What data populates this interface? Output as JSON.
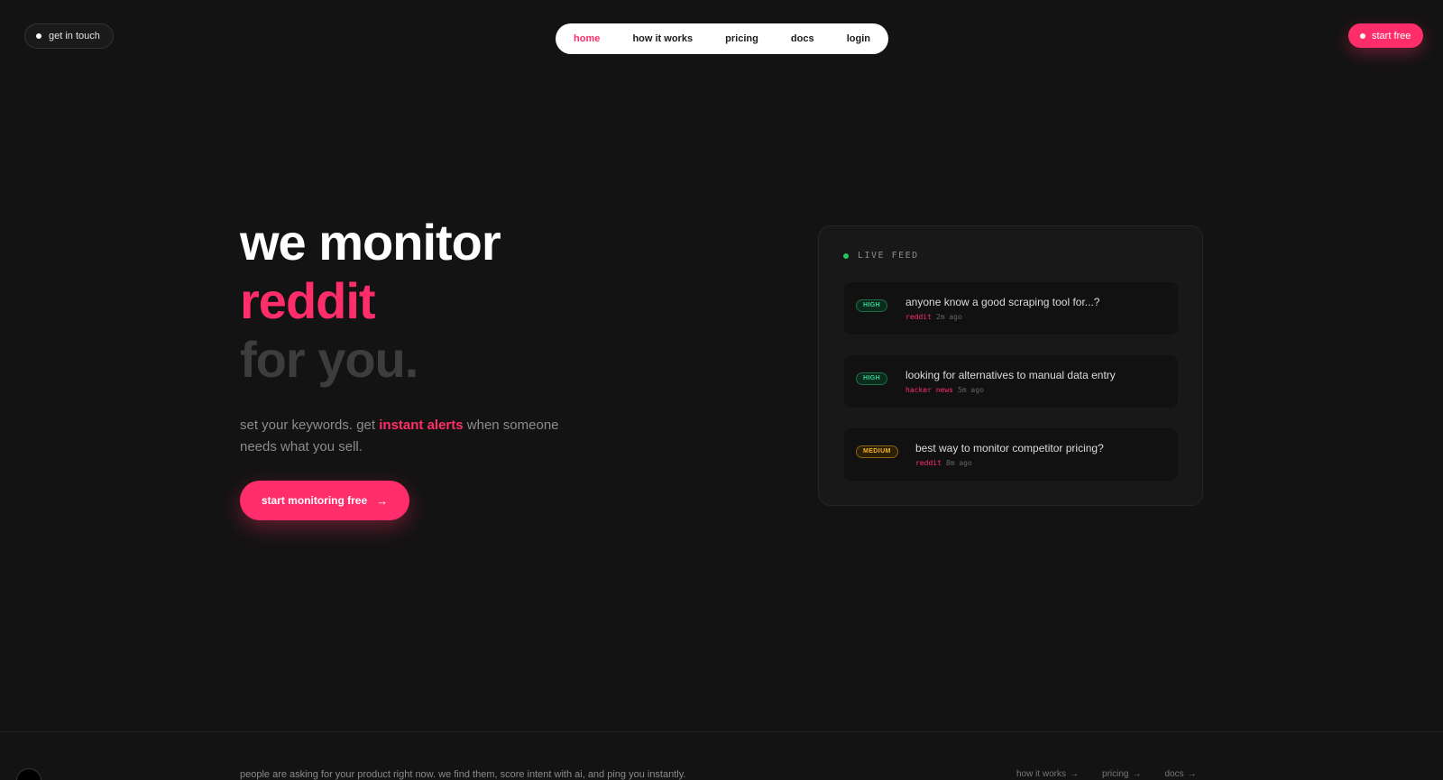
{
  "header": {
    "contact_label": "get in touch",
    "start_label": "start free",
    "nav": [
      {
        "label": "home"
      },
      {
        "label": "how it works"
      },
      {
        "label": "pricing"
      },
      {
        "label": "docs"
      },
      {
        "label": "login"
      }
    ]
  },
  "hero": {
    "line1": "we monitor",
    "line2": "reddit",
    "line3": "for you.",
    "sub_pre": "set your keywords. get ",
    "sub_highlight": "instant alerts",
    "sub_post": " when someone needs what you sell.",
    "cta_label": "start monitoring free",
    "cta_arrow": "→"
  },
  "feed": {
    "heading": "LIVE FEED",
    "items": [
      {
        "badge": "HIGH",
        "title": "anyone know a good scraping tool for...?",
        "source": "reddit",
        "time": "2m ago"
      },
      {
        "badge": "HIGH",
        "title": "looking for alternatives to manual data entry",
        "source": "hacker news",
        "time": "5m ago"
      },
      {
        "badge": "MEDIUM",
        "title": "best way to monitor competitor pricing?",
        "source": "reddit",
        "time": "8m ago"
      }
    ]
  },
  "footer": {
    "text": "people are asking for your product right now. we find them, score intent with ai, and ping you instantly.",
    "links": [
      {
        "label": "how it works",
        "arrow": "→"
      },
      {
        "label": "pricing",
        "arrow": "→"
      },
      {
        "label": "docs",
        "arrow": "→"
      }
    ]
  },
  "colors": {
    "accent": "#ff2d6a",
    "background": "#131313",
    "high": "#34d399",
    "medium": "#f5b324"
  }
}
